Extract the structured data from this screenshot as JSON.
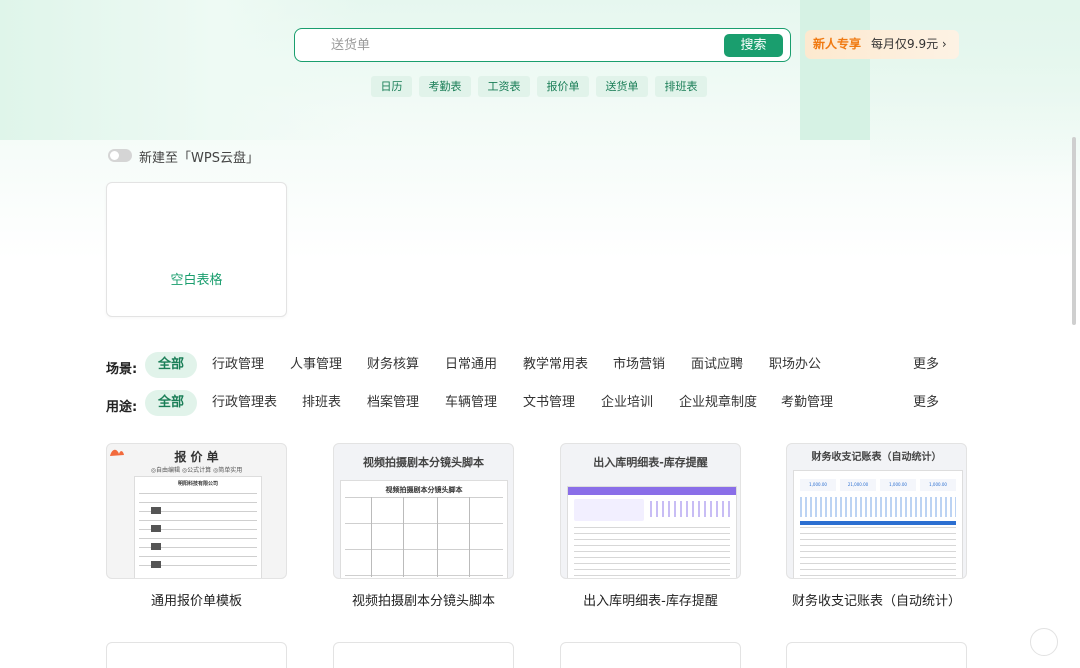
{
  "search": {
    "placeholder": "送货单",
    "button_label": "搜索"
  },
  "promo": {
    "badge": "新人专享",
    "text": "每月仅9.9元 ›"
  },
  "quick_tags": [
    "日历",
    "考勤表",
    "工资表",
    "报价单",
    "送货单",
    "排班表"
  ],
  "cloud_toggle": {
    "label": "新建至「WPS云盘」",
    "on": false
  },
  "blank_card": {
    "label": "空白表格"
  },
  "scene_filter": {
    "label": "场景:",
    "options": [
      "全部",
      "行政管理",
      "人事管理",
      "财务核算",
      "日常通用",
      "教学常用表",
      "市场营销",
      "面试应聘",
      "职场办公"
    ],
    "selected": "全部",
    "more": "更多"
  },
  "usage_filter": {
    "label": "用途:",
    "options": [
      "全部",
      "行政管理表",
      "排班表",
      "档案管理",
      "车辆管理",
      "文书管理",
      "企业培训",
      "企业规章制度",
      "考勤管理"
    ],
    "selected": "全部",
    "more": "更多"
  },
  "templates": [
    {
      "name": "通用报价单模板",
      "thumb_title": "报 价 单",
      "thumb_subtitle": "◎自由编辑  ◎公式计算  ◎简单实用",
      "thumb_company": "明阳科技有限公司"
    },
    {
      "name": "视频拍摄剧本分镜头脚本",
      "thumb_title": "视频拍摄剧本分镜头脚本",
      "thumb_subtitle": "视频拍摄剧本分镜头脚本"
    },
    {
      "name": "出入库明细表-库存提醒",
      "thumb_title": "出入库明细表-库存提醒"
    },
    {
      "name": "财务收支记账表（自动统计）",
      "thumb_title": "财务收支记账表（自动统计）",
      "thumb_stats": [
        "1,000.00",
        "21,000.00",
        "1,000.00",
        "1,000.00"
      ]
    }
  ],
  "colors": {
    "accent": "#1a9e6e",
    "accent_light": "#e1f3ea",
    "promo_orange": "#f07a12"
  }
}
